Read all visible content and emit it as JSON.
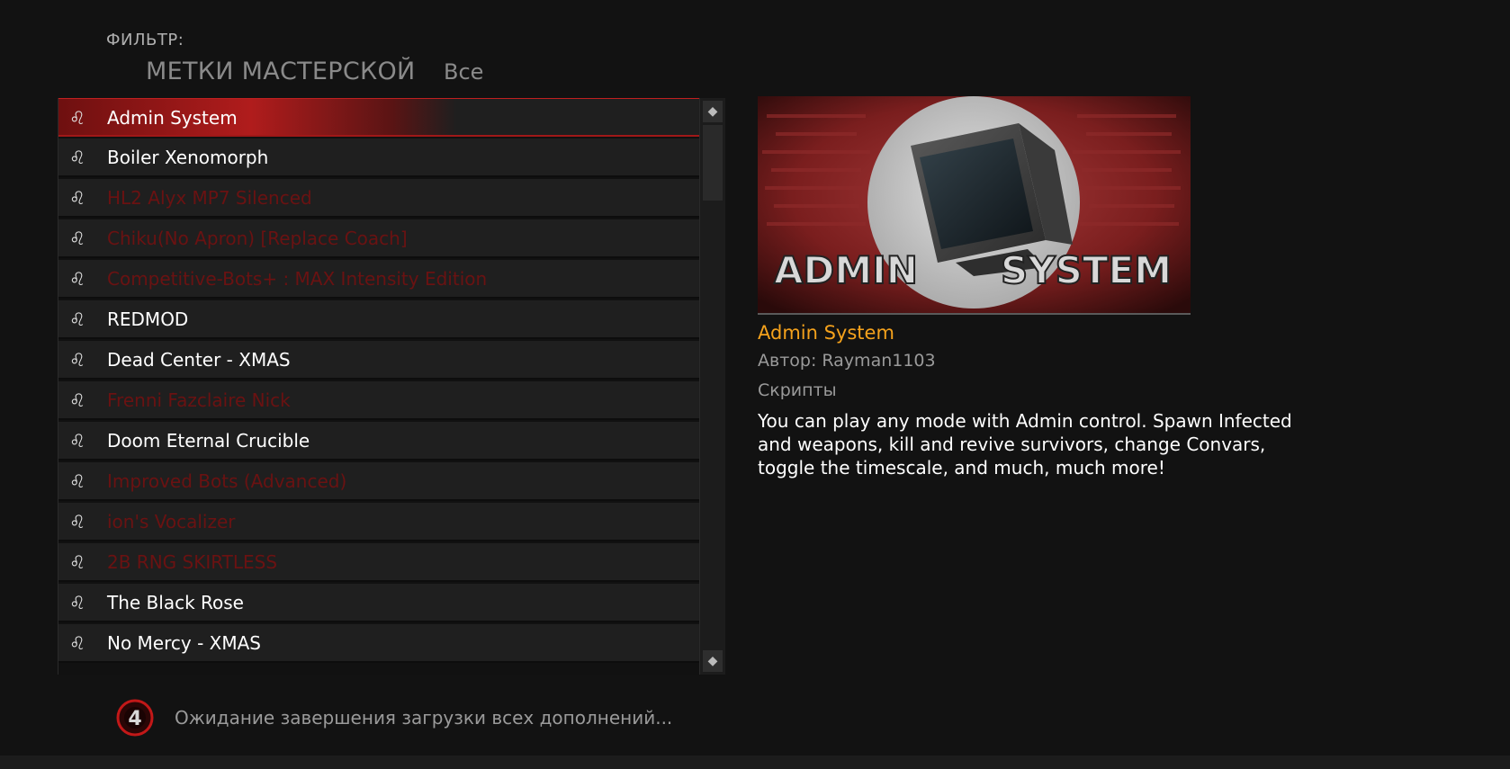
{
  "filter": {
    "label": "ФИЛЬТР:",
    "category": "МЕТКИ МАСТЕРСКОЙ",
    "value": "Все"
  },
  "addons": [
    {
      "name": "Admin System",
      "enabled": true,
      "selected": true
    },
    {
      "name": "Boiler Xenomorph",
      "enabled": true
    },
    {
      "name": "HL2 Alyx MP7 Silenced",
      "enabled": false
    },
    {
      "name": "Chiku(No Apron) [Replace Coach]",
      "enabled": false
    },
    {
      "name": "Competitive-Bots+ : MAX Intensity Edition",
      "enabled": false
    },
    {
      "name": "REDMOD",
      "enabled": true
    },
    {
      "name": "Dead Center - XMAS",
      "enabled": true
    },
    {
      "name": "Frenni Fazclaire Nick",
      "enabled": false
    },
    {
      "name": "Doom Eternal Crucible",
      "enabled": true
    },
    {
      "name": "Improved Bots (Advanced)",
      "enabled": false
    },
    {
      "name": "ion's Vocalizer",
      "enabled": false
    },
    {
      "name": "2B RNG SKIRTLESS",
      "enabled": false
    },
    {
      "name": "The Black Rose",
      "enabled": true
    },
    {
      "name": "No Mercy - XMAS",
      "enabled": true
    }
  ],
  "details": {
    "preview_text_left": "ADMIN",
    "preview_text_right": "SYSTEM",
    "title": "Admin System",
    "author": "Автор: Rayman1103",
    "category": "Скрипты",
    "description": "You can play any mode with Admin control. Spawn Infected and weapons, kill and revive survivors, change Convars, toggle the timescale, and much, much more!"
  },
  "status": {
    "text": "Ожидание завершения загрузки всех дополнений..."
  },
  "colors": {
    "accent": "#f5a21c",
    "selected_row": "#b01c1c",
    "disabled_text": "#6a1212",
    "background": "#121212"
  },
  "icons": {
    "row_icon": "workshop-addon-icon",
    "logo": "l4d2-logo-icon"
  }
}
